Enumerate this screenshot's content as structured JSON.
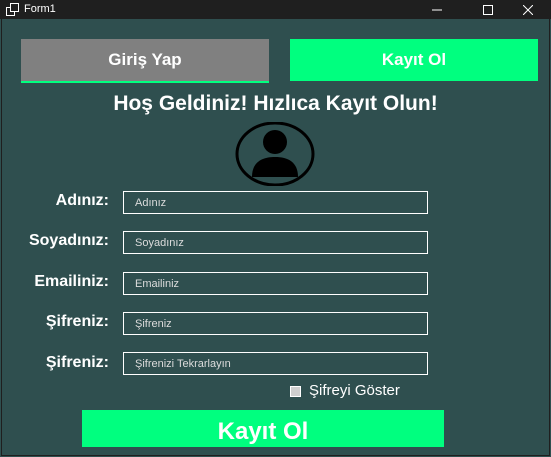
{
  "window": {
    "title": "Form1",
    "icon": "form-icon",
    "controls": [
      "minimize-icon",
      "maximize-icon",
      "close-icon"
    ]
  },
  "tabs": {
    "login_label": "Giriş Yap",
    "register_label": "Kayıt Ol",
    "active": "register"
  },
  "heading": "Hoş Geldiniz! Hızlıca Kayıt Olun!",
  "avatar_icon": "user-avatar-icon",
  "fields": [
    {
      "label": "Adınız:",
      "placeholder": "Adınız",
      "value": ""
    },
    {
      "label": "Soyadınız:",
      "placeholder": "Soyadınız",
      "value": ""
    },
    {
      "label": "Emailiniz:",
      "placeholder": "Emailiniz",
      "value": ""
    },
    {
      "label": "Şifreniz:",
      "placeholder": "Şifreniz",
      "value": ""
    },
    {
      "label": "Şifreniz:",
      "placeholder": "Şifrenizi Tekrarlayın",
      "value": ""
    }
  ],
  "show_password": {
    "label": "Şifreyi Göster",
    "checked": false
  },
  "submit_label": "Kayıt Ol",
  "colors": {
    "background": "#2f4f4f",
    "accent": "#00ff7f",
    "inactive_tab": "#808080",
    "titlebar": "#1f1f1f",
    "text": "#ffffff"
  }
}
